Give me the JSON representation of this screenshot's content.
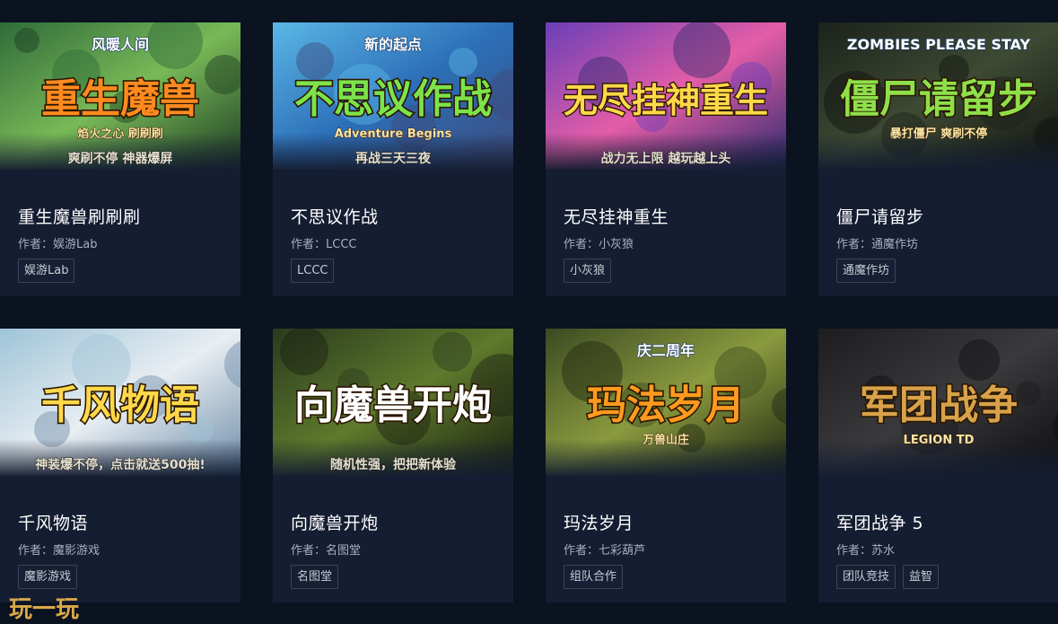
{
  "games": [
    {
      "title": "重生魔兽刷刷刷",
      "author": "作者：娱游Lab",
      "tags": [
        "娱游Lab"
      ],
      "cover": {
        "big": "重生魔兽",
        "top": "风暖人间",
        "mid": "焰火之心 刷刷刷",
        "bottom": "爽刷不停 神器爆屏",
        "palette": [
          "#2f6b3a",
          "#78b957",
          "#1c3a22"
        ],
        "accent": "#ff8a1f"
      }
    },
    {
      "title": "不思议作战",
      "author": "作者：LCCC",
      "tags": [
        "LCCC"
      ],
      "cover": {
        "big": "不思议作战",
        "top": "新的起点",
        "mid": "Adventure Begins",
        "bottom": "再战三天三夜",
        "palette": [
          "#5bb7e6",
          "#2c6fb8",
          "#3f4a7a"
        ],
        "accent": "#7ce34a"
      }
    },
    {
      "title": "无尽挂神重生",
      "author": "作者：小灰狼",
      "tags": [
        "小灰狼"
      ],
      "cover": {
        "big": "无尽挂神重生",
        "top": "",
        "mid": "",
        "bottom": "战力无上限 越玩越上头",
        "palette": [
          "#6a3fb8",
          "#e45da7",
          "#2c2a6e"
        ],
        "accent": "#ffd84a"
      }
    },
    {
      "title": "僵尸请留步",
      "author": "作者：通魔作坊",
      "tags": [
        "通魔作坊"
      ],
      "cover": {
        "big": "僵尸请留步",
        "top": "ZOMBIES PLEASE STAY",
        "mid": "暴打僵尸 爽刷不停",
        "bottom": "",
        "palette": [
          "#1c221c",
          "#3e4a33",
          "#0f120f"
        ],
        "accent": "#8ee04a"
      }
    },
    {
      "title": "千风物语",
      "author": "作者：魔影游戏",
      "tags": [
        "魔影游戏"
      ],
      "cover": {
        "big": "千风物语",
        "top": "",
        "mid": "",
        "bottom": "神装爆不停，点击就送500抽!",
        "palette": [
          "#9fc4d8",
          "#e8eef2",
          "#6b8aa8"
        ],
        "accent": "#ffd84a"
      }
    },
    {
      "title": "向魔兽开炮",
      "author": "作者：名图堂",
      "tags": [
        "名图堂"
      ],
      "cover": {
        "big": "向魔兽开炮",
        "top": "",
        "mid": "",
        "bottom": "随机性强，把把新体验",
        "palette": [
          "#2a3a1e",
          "#5e7a2c",
          "#1a1f12"
        ],
        "accent": "#ffffff"
      }
    },
    {
      "title": "玛法岁月",
      "author": "作者：七彩葫芦",
      "tags": [
        "组队合作"
      ],
      "cover": {
        "big": "玛法岁月",
        "top": "庆二周年",
        "mid": "万兽山庄",
        "bottom": "",
        "palette": [
          "#3c4a22",
          "#8a9a3e",
          "#1f2612"
        ],
        "accent": "#ff9a1f"
      }
    },
    {
      "title": "军团战争 5",
      "author": "作者：苏水",
      "tags": [
        "团队竞技",
        "益智"
      ],
      "cover": {
        "big": "军团战争",
        "top": "",
        "mid": "LEGION TD",
        "bottom": "",
        "palette": [
          "#1d1d1f",
          "#3a3a3c",
          "#0d0d0f"
        ],
        "accent": "#d8a24a"
      }
    }
  ],
  "watermark": "玩一玩"
}
